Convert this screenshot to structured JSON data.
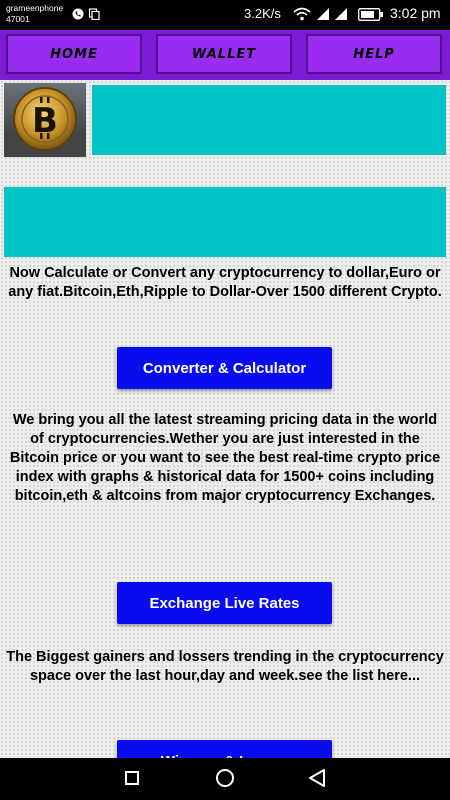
{
  "status_bar": {
    "carrier": "grameenphone",
    "carrier_code": "47001",
    "net_speed": "3.2K/s",
    "battery": "",
    "time": "3:02 pm"
  },
  "nav": {
    "home": "HOME",
    "wallet": "WALLET",
    "help": "HELP"
  },
  "banner_color": "#00c4c4",
  "accent_color": "#0a0bef",
  "nav_color": "#7d1cd6",
  "content": {
    "intro_text": "Now Calculate or Convert any cryptocurrency to dollar,Euro or any fiat.Bitcoin,Eth,Ripple to Dollar-Over 1500 different Crypto.",
    "converter_button": "Converter & Calculator",
    "streaming_text": "We bring you all the latest streaming pricing data in the world of cryptocurrencies.Wether you are just interested in the Bitcoin price or you want to see the best real-time crypto price index with graphs & historical data for 1500+ coins including bitcoin,eth & altcoins from major cryptocurrency Exchanges.",
    "exchange_button": "Exchange Live Rates",
    "gainers_text": "The Biggest gainers and lossers trending in the cryptocurrency space over the last hour,day and week.see the list here...",
    "third_button": "Winners & Losers"
  },
  "icons": [
    "phone-icon",
    "copy-icon",
    "signal-icon",
    "wifi-icon",
    "battery-icon",
    "bitcoin-image",
    "square-nav-icon",
    "circle-nav-icon",
    "back-nav-icon"
  ]
}
